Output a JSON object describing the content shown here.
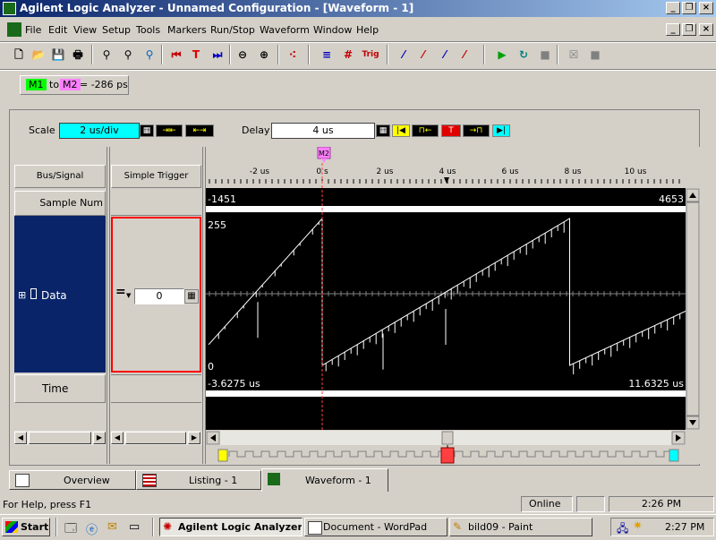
{
  "window": {
    "title": "Agilent Logic Analyzer - Unnamed Configuration - [Waveform - 1]"
  },
  "menu": [
    "File",
    "Edit",
    "View",
    "Setup",
    "Tools",
    "Markers",
    "Run/Stop",
    "Waveform",
    "Window",
    "Help"
  ],
  "marker_bar": {
    "m1": "M1",
    "to": "to",
    "m2": "M2",
    "readout": "= -286 ps"
  },
  "scale": {
    "label": "Scale",
    "value": "2 us/div"
  },
  "delay": {
    "label": "Delay",
    "value": "4 us"
  },
  "columns": {
    "bus_signal": "Bus/Signal",
    "simple_trigger": "Simple Trigger"
  },
  "rows": {
    "sample_num": "Sample Num",
    "data": "Data",
    "time": "Time"
  },
  "trigger": {
    "operator": "=",
    "value": "0"
  },
  "marker_label": "M2",
  "time_axis": {
    "ticks": [
      "-2 us",
      "0 s",
      "2 us",
      "4 us",
      "6 us",
      "8 us",
      "10 us"
    ]
  },
  "sample_row": {
    "left": "-1451",
    "right": "4653"
  },
  "data_row": {
    "top": "255",
    "bottom": "0"
  },
  "time_row": {
    "left": "-3.6275 us",
    "right": "11.6325 us"
  },
  "tabs": [
    "Overview",
    "Listing - 1",
    "Waveform - 1"
  ],
  "status": {
    "help": "For Help, press F1",
    "online": "Online",
    "time": "2:26 PM"
  },
  "taskbar": {
    "start": "Start",
    "items": [
      "Agilent Logic Analyzer...",
      "Document - WordPad",
      "bild09 - Paint"
    ],
    "clock": "2:27 PM"
  },
  "colors": {
    "title_active": "#0a246a",
    "scale_field": "#00ffff",
    "waveform_bg": "#000000",
    "signal_selected": "#0a246a",
    "marker_m1": "#00ff00",
    "marker_m2": "#ff80ff",
    "trigger_border": "#ff0000"
  }
}
